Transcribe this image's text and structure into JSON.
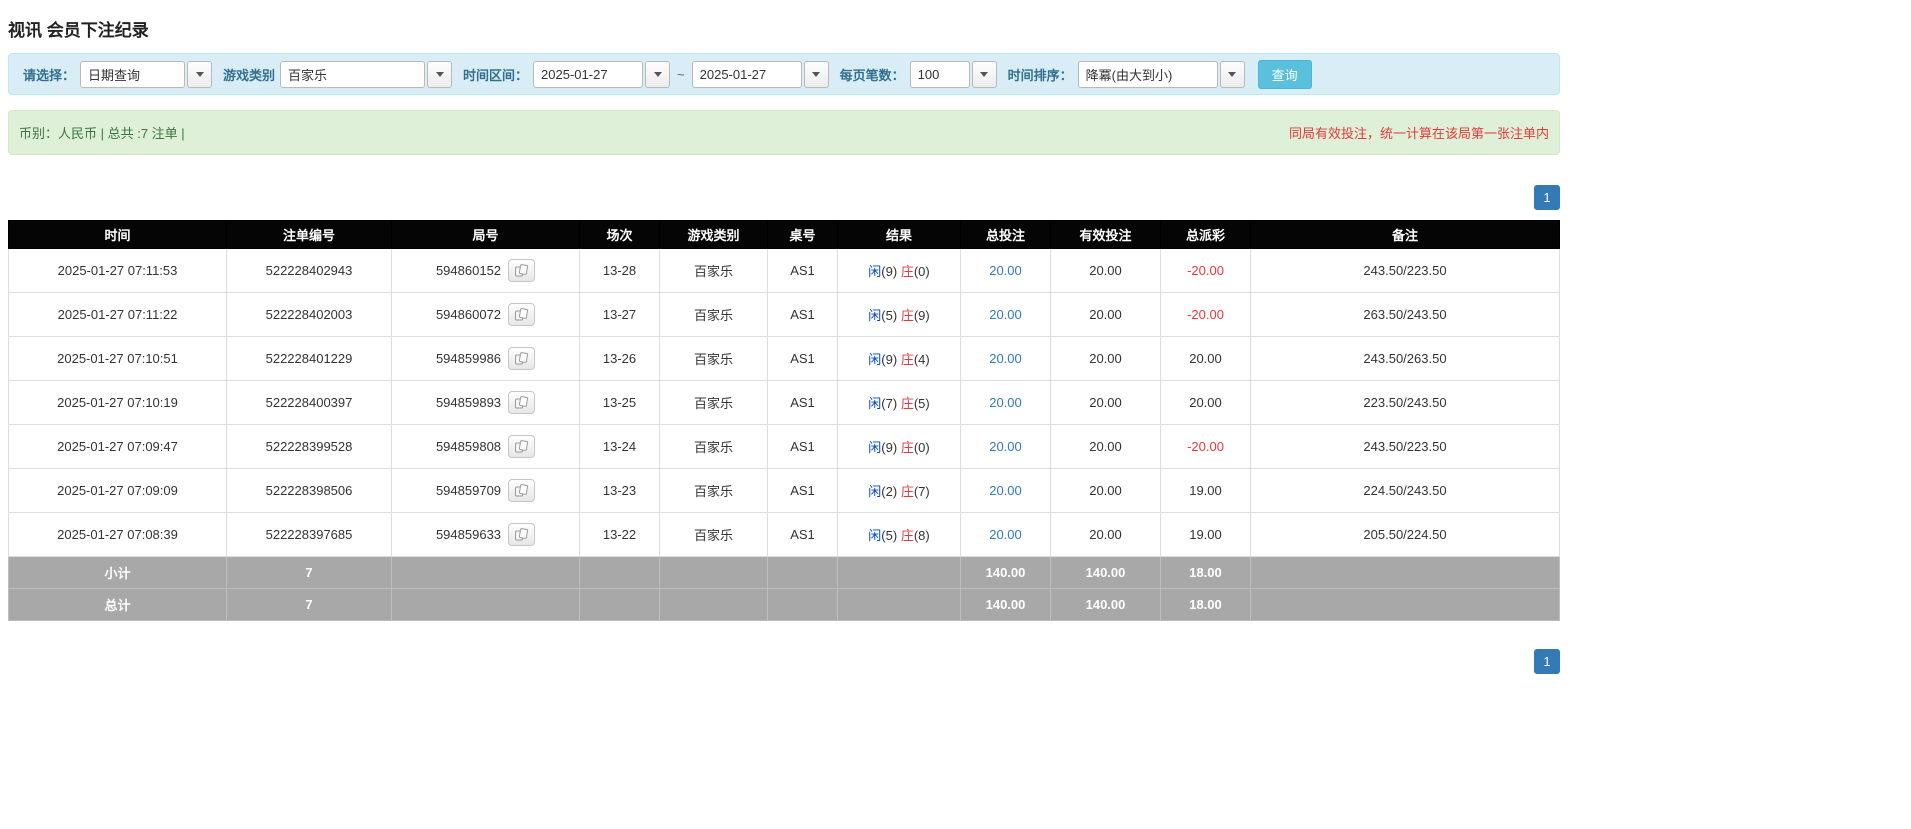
{
  "page": {
    "title": "视讯 会员下注纪录"
  },
  "filters": {
    "select_label": "请选择：",
    "select_value": "日期查询",
    "game_type_label": "游戏类别",
    "game_type_value": "百家乐",
    "date_range_label": "时间区间：",
    "date_from": "2025-01-27",
    "date_separator": "~",
    "date_to": "2025-01-27",
    "page_size_label": "每页笔数：",
    "page_size_value": "100",
    "sort_label": "时间排序：",
    "sort_value": "降冪(由大到小)",
    "search_button_label": "查询"
  },
  "summary_bar": {
    "left_text": "币别：人民币 | 总共 :7 注单 |",
    "right_notice": "同局有效投注，统一计算在该局第一张注单内"
  },
  "pagination": {
    "page": "1"
  },
  "table": {
    "headers": [
      "时间",
      "注单编号",
      "局号",
      "场次",
      "游戏类别",
      "桌号",
      "结果",
      "总投注",
      "有效投注",
      "总派彩",
      "备注"
    ],
    "rows": [
      {
        "time": "2025-01-27 07:11:53",
        "bet_id": "522228402943",
        "round_id": "594860152",
        "session": "13-28",
        "game": "百家乐",
        "table_no": "AS1",
        "player": "闲",
        "player_num": "(9)",
        "banker": "庄",
        "banker_num": "(0)",
        "total_bet": "20.00",
        "valid_bet": "20.00",
        "payout": "-20.00",
        "remark": "243.50/223.50"
      },
      {
        "time": "2025-01-27 07:11:22",
        "bet_id": "522228402003",
        "round_id": "594860072",
        "session": "13-27",
        "game": "百家乐",
        "table_no": "AS1",
        "player": "闲",
        "player_num": "(5)",
        "banker": "庄",
        "banker_num": "(9)",
        "total_bet": "20.00",
        "valid_bet": "20.00",
        "payout": "-20.00",
        "remark": "263.50/243.50"
      },
      {
        "time": "2025-01-27 07:10:51",
        "bet_id": "522228401229",
        "round_id": "594859986",
        "session": "13-26",
        "game": "百家乐",
        "table_no": "AS1",
        "player": "闲",
        "player_num": "(9)",
        "banker": "庄",
        "banker_num": "(4)",
        "total_bet": "20.00",
        "valid_bet": "20.00",
        "payout": "20.00",
        "remark": "243.50/263.50"
      },
      {
        "time": "2025-01-27 07:10:19",
        "bet_id": "522228400397",
        "round_id": "594859893",
        "session": "13-25",
        "game": "百家乐",
        "table_no": "AS1",
        "player": "闲",
        "player_num": "(7)",
        "banker": "庄",
        "banker_num": "(5)",
        "total_bet": "20.00",
        "valid_bet": "20.00",
        "payout": "20.00",
        "remark": "223.50/243.50"
      },
      {
        "time": "2025-01-27 07:09:47",
        "bet_id": "522228399528",
        "round_id": "594859808",
        "session": "13-24",
        "game": "百家乐",
        "table_no": "AS1",
        "player": "闲",
        "player_num": "(9)",
        "banker": "庄",
        "banker_num": "(0)",
        "total_bet": "20.00",
        "valid_bet": "20.00",
        "payout": "-20.00",
        "remark": "243.50/223.50"
      },
      {
        "time": "2025-01-27 07:09:09",
        "bet_id": "522228398506",
        "round_id": "594859709",
        "session": "13-23",
        "game": "百家乐",
        "table_no": "AS1",
        "player": "闲",
        "player_num": "(2)",
        "banker": "庄",
        "banker_num": "(7)",
        "total_bet": "20.00",
        "valid_bet": "20.00",
        "payout": "19.00",
        "remark": "224.50/243.50"
      },
      {
        "time": "2025-01-27 07:08:39",
        "bet_id": "522228397685",
        "round_id": "594859633",
        "session": "13-22",
        "game": "百家乐",
        "table_no": "AS1",
        "player": "闲",
        "player_num": "(5)",
        "banker": "庄",
        "banker_num": "(8)",
        "total_bet": "20.00",
        "valid_bet": "20.00",
        "payout": "19.00",
        "remark": "205.50/224.50"
      }
    ],
    "subtotal": {
      "label": "小计",
      "count": "7",
      "total_bet": "140.00",
      "valid_bet": "140.00",
      "payout": "18.00"
    },
    "total": {
      "label": "总计",
      "count": "7",
      "total_bet": "140.00",
      "valid_bet": "140.00",
      "payout": "18.00"
    }
  }
}
